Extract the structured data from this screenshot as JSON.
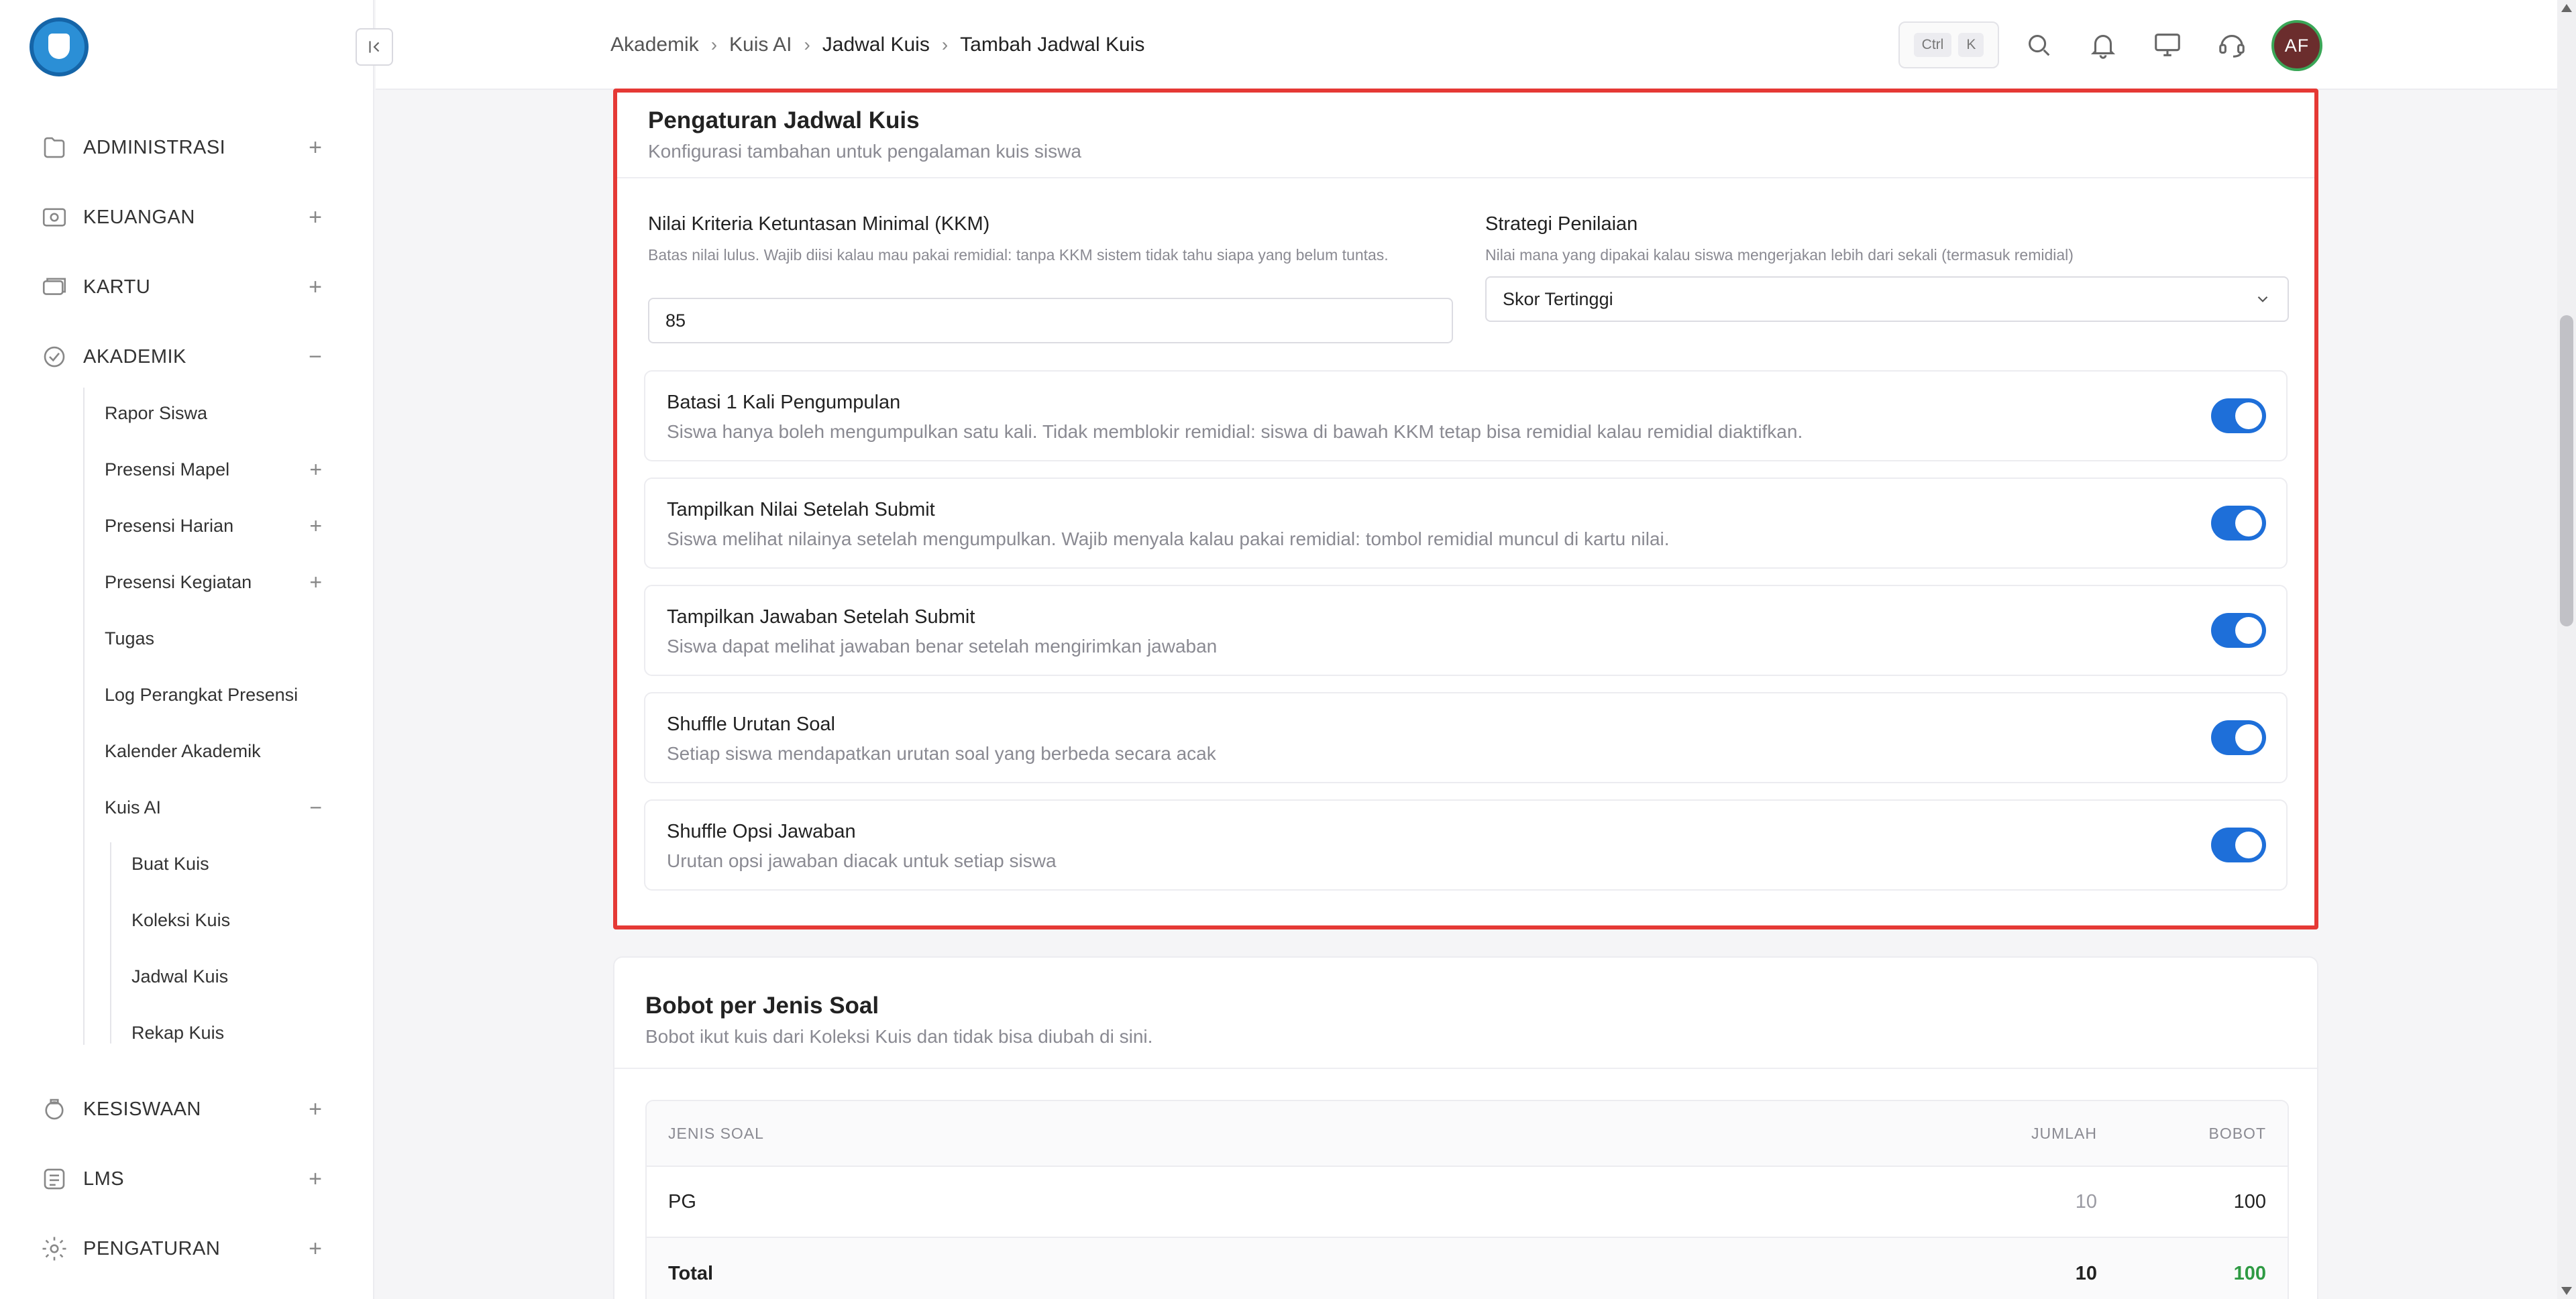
{
  "sidebar": {
    "menu": [
      {
        "label": "ADMINISTRASI",
        "toggle": "+"
      },
      {
        "label": "KEUANGAN",
        "toggle": "+"
      },
      {
        "label": "KARTU",
        "toggle": "+"
      },
      {
        "label": "AKADEMIK",
        "toggle": "−"
      },
      {
        "label": "KESISWAAN",
        "toggle": "+"
      },
      {
        "label": "LMS",
        "toggle": "+"
      },
      {
        "label": "PENGATURAN",
        "toggle": "+"
      }
    ],
    "akademik_items": [
      {
        "label": "Rapor Siswa",
        "toggle": ""
      },
      {
        "label": "Presensi Mapel",
        "toggle": "+"
      },
      {
        "label": "Presensi Harian",
        "toggle": "+"
      },
      {
        "label": "Presensi Kegiatan",
        "toggle": "+"
      },
      {
        "label": "Tugas",
        "toggle": ""
      },
      {
        "label": "Log Perangkat Presensi",
        "toggle": ""
      },
      {
        "label": "Kalender Akademik",
        "toggle": ""
      },
      {
        "label": "Kuis AI",
        "toggle": "−"
      }
    ],
    "kuis_items": [
      {
        "label": "Buat Kuis"
      },
      {
        "label": "Koleksi Kuis"
      },
      {
        "label": "Jadwal Kuis"
      },
      {
        "label": "Rekap Kuis"
      }
    ]
  },
  "topbar": {
    "breadcrumb": [
      "Akademik",
      "Kuis AI",
      "Jadwal Kuis",
      "Tambah Jadwal Kuis"
    ],
    "shortcut": {
      "key1": "Ctrl",
      "key2": "K"
    },
    "avatar_initials": "AF"
  },
  "settings": {
    "title": "Pengaturan Jadwal Kuis",
    "subtitle": "Konfigurasi tambahan untuk pengalaman kuis siswa",
    "kkm": {
      "label": "Nilai Kriteria Ketuntasan Minimal (KKM)",
      "help": "Batas nilai lulus. Wajib diisi kalau mau pakai remidial: tanpa KKM sistem tidak tahu siapa yang belum tuntas.",
      "value": "85"
    },
    "strategy": {
      "label": "Strategi Penilaian",
      "help": "Nilai mana yang dipakai kalau siswa mengerjakan lebih dari sekali (termasuk remidial)",
      "value": "Skor Tertinggi"
    },
    "toggles": [
      {
        "title": "Batasi 1 Kali Pengumpulan",
        "desc": "Siswa hanya boleh mengumpulkan satu kali. Tidak memblokir remidial: siswa di bawah KKM tetap bisa remidial kalau remidial diaktifkan.",
        "on": true
      },
      {
        "title": "Tampilkan Nilai Setelah Submit",
        "desc": "Siswa melihat nilainya setelah mengumpulkan. Wajib menyala kalau pakai remidial: tombol remidial muncul di kartu nilai.",
        "on": true
      },
      {
        "title": "Tampilkan Jawaban Setelah Submit",
        "desc": "Siswa dapat melihat jawaban benar setelah mengirimkan jawaban",
        "on": true
      },
      {
        "title": "Shuffle Urutan Soal",
        "desc": "Setiap siswa mendapatkan urutan soal yang berbeda secara acak",
        "on": true
      },
      {
        "title": "Shuffle Opsi Jawaban",
        "desc": "Urutan opsi jawaban diacak untuk setiap siswa",
        "on": true
      }
    ]
  },
  "bobot": {
    "title": "Bobot per Jenis Soal",
    "subtitle": "Bobot ikut kuis dari Koleksi Kuis dan tidak bisa diubah di sini.",
    "headers": {
      "jenis": "JENIS SOAL",
      "jumlah": "JUMLAH",
      "bobot": "BOBOT"
    },
    "rows": [
      {
        "jenis": "PG",
        "jumlah": "10",
        "bobot": "100"
      }
    ],
    "total": {
      "label": "Total",
      "jumlah": "10",
      "bobot": "100"
    }
  },
  "colors": {
    "accent": "#1e6fd9",
    "highlight": "#e53935",
    "total_green": "#2e9a43"
  }
}
